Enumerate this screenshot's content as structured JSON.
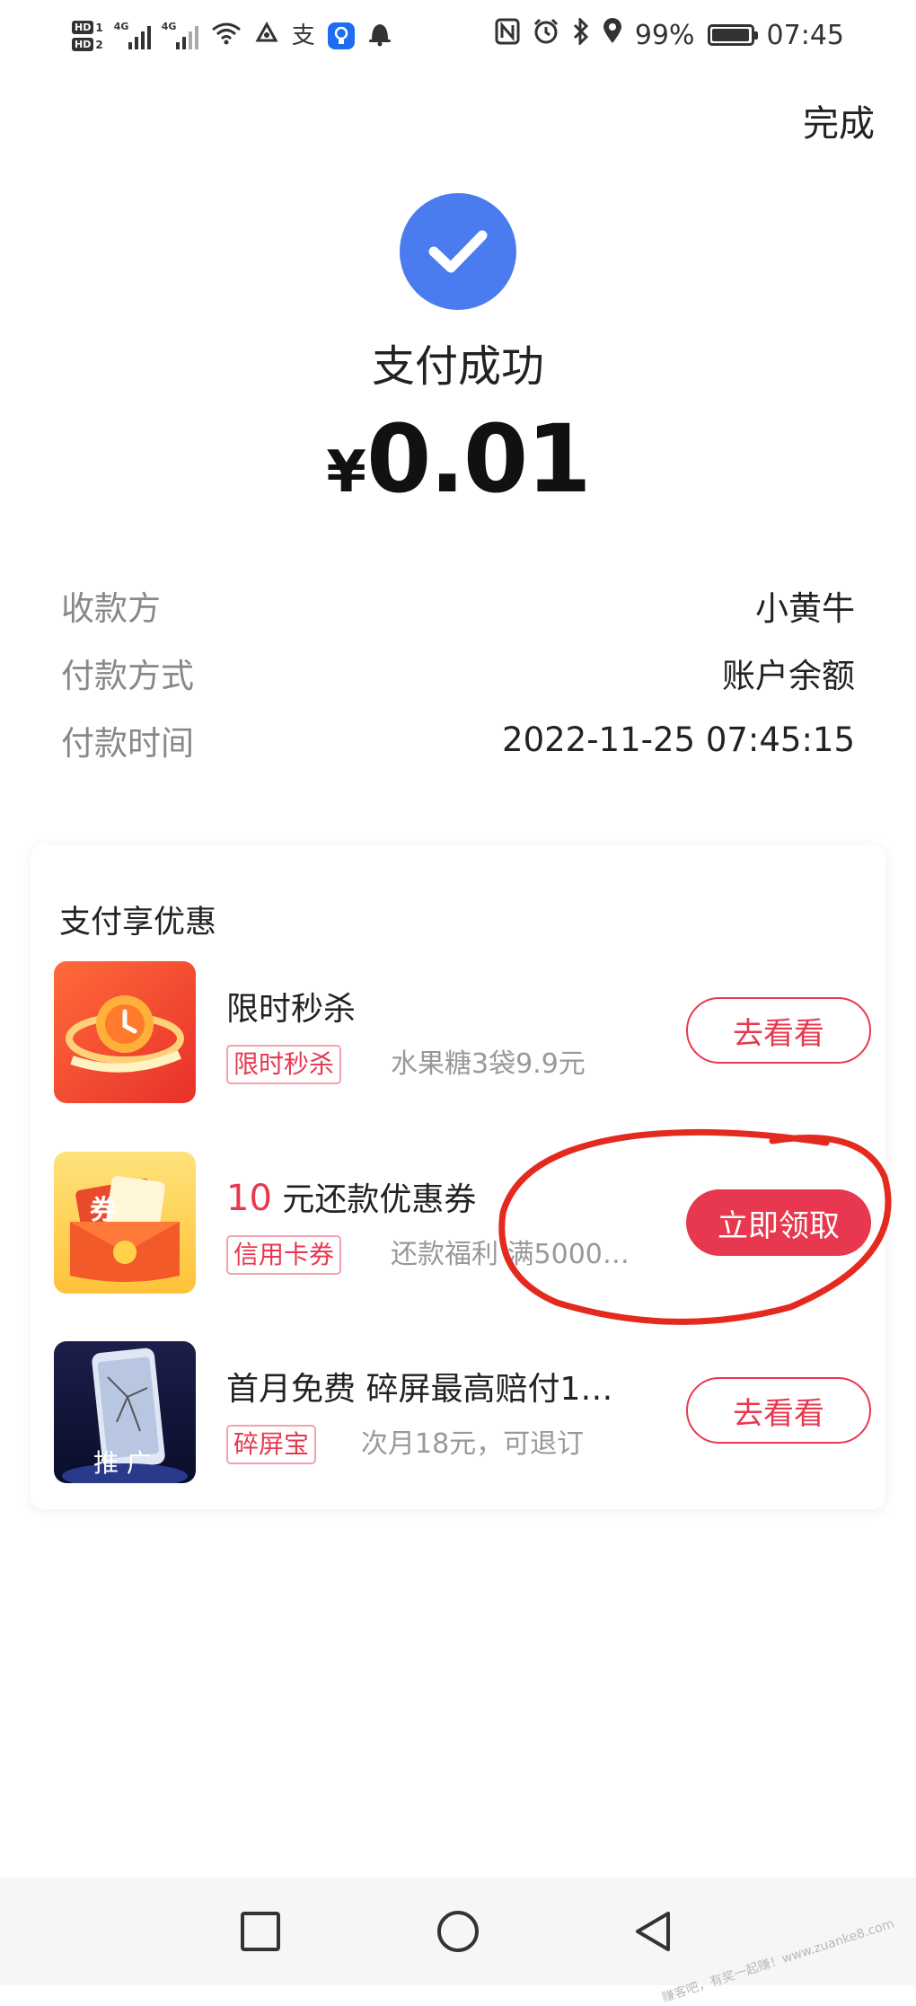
{
  "status_bar": {
    "hd1": "HD",
    "hd1_num": "1",
    "hd2": "HD",
    "hd2_num": "2",
    "net1": "4G",
    "net2": "4G",
    "alipay_glyph": "支",
    "battery_text": "99%",
    "battery_level": 0.99,
    "time": "07:45",
    "icons": [
      "wifi-icon",
      "app-notification-icon",
      "alipay-icon",
      "light-bulb-icon",
      "bell-icon",
      "nfc-icon",
      "alarm-icon",
      "bluetooth-icon",
      "location-icon",
      "battery-icon"
    ]
  },
  "header": {
    "done_label": "完成"
  },
  "result": {
    "icon": "check-icon",
    "title": "支付成功",
    "currency": "¥",
    "amount": "0.01",
    "accent_color": "#4a7cf0"
  },
  "details": [
    {
      "label": "收款方",
      "value": "小黄牛"
    },
    {
      "label": "付款方式",
      "value": "账户余额"
    },
    {
      "label": "付款时间",
      "value": "2022-11-25 07:45:15"
    }
  ],
  "promo": {
    "title": "支付享优惠",
    "items": [
      {
        "thumb": "flash-sale-thumb",
        "name": "限时秒杀",
        "tag": "限时秒杀",
        "desc": "水果糖3袋9.9元",
        "button": "去看看"
      },
      {
        "thumb": "coupon-envelope-thumb",
        "thumb_text": "券",
        "name_highlight": "10",
        "name_rest": " 元还款优惠券",
        "tag": "信用卡券",
        "desc": "还款福利 满5000…",
        "button": "立即领取"
      },
      {
        "thumb": "cracked-phone-thumb",
        "thumb_text": "推 广",
        "name": "首月免费  碎屏最高赔付1…",
        "tag": "碎屏宝",
        "desc": "次月18元，可退订",
        "button": "去看看"
      }
    ],
    "accent_color": "#e8384f"
  },
  "nav": {
    "icons": [
      "recent-apps-icon",
      "home-icon",
      "back-icon"
    ]
  },
  "watermark": "赚客吧，有奖一起赚！www.zuanke8.com"
}
